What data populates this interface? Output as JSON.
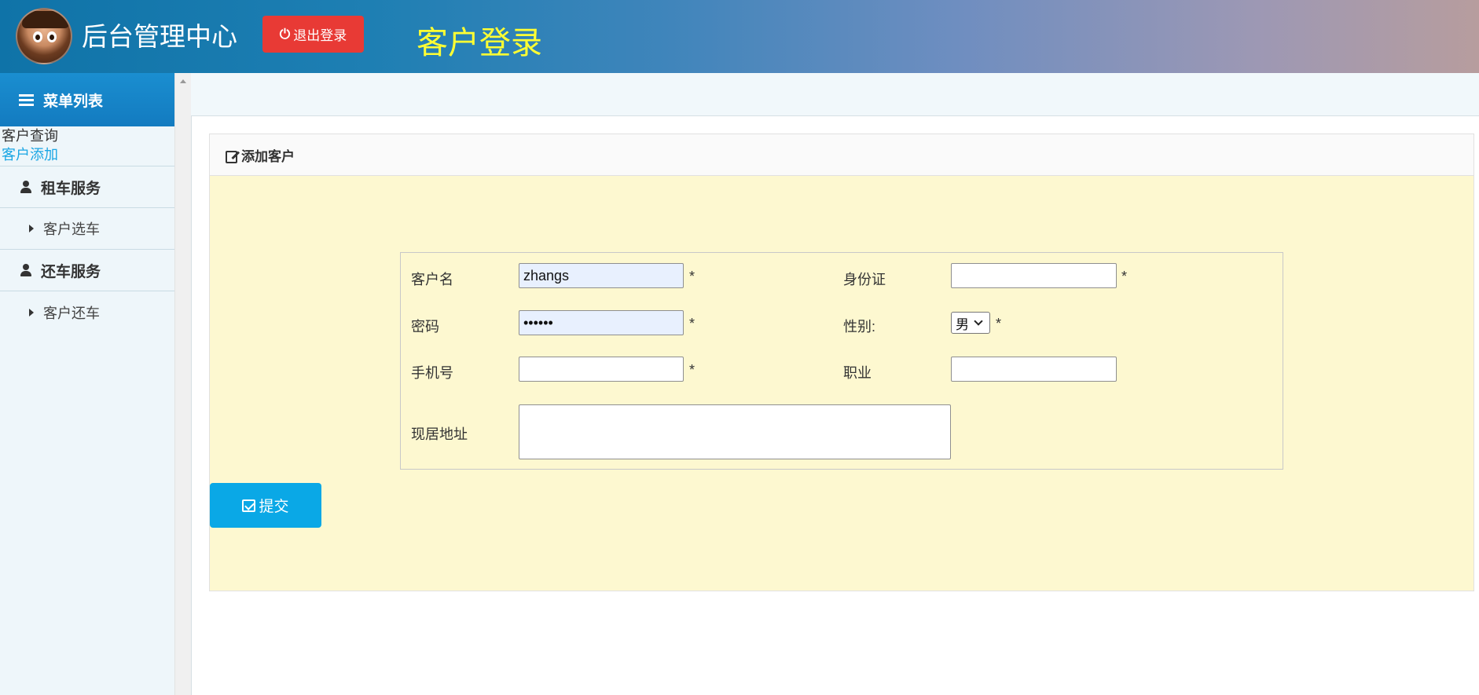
{
  "header": {
    "app_title": "后台管理中心",
    "logout_label": "退出登录",
    "page_heading": "客户登录"
  },
  "sidebar": {
    "menu_title": "菜单列表",
    "links": [
      {
        "label": "客户查询"
      },
      {
        "label": "客户添加"
      }
    ],
    "groups": [
      {
        "title": "租车服务",
        "items": [
          "客户选车"
        ]
      },
      {
        "title": "还车服务",
        "items": [
          "客户还车"
        ]
      }
    ]
  },
  "panel": {
    "title": "添加客户",
    "submit_label": "提交"
  },
  "form": {
    "username_label": "客户名",
    "username_value": "zhangs",
    "password_label": "密码",
    "password_value": "••••••",
    "phone_label": "手机号",
    "phone_value": "",
    "address_label": "现居地址",
    "address_value": "",
    "idcard_label": "身份证",
    "idcard_value": "",
    "gender_label": "性别:",
    "gender_value": "男",
    "job_label": "职业",
    "job_value": "",
    "required_mark": "*"
  },
  "colors": {
    "header_gradient_start": "#0f73a8",
    "logout_red": "#e83a35",
    "heading_yellow": "#ffff33",
    "active_link": "#1aa6e4",
    "panel_bg": "#fdf8d0",
    "submit_blue": "#0aa8e6"
  }
}
